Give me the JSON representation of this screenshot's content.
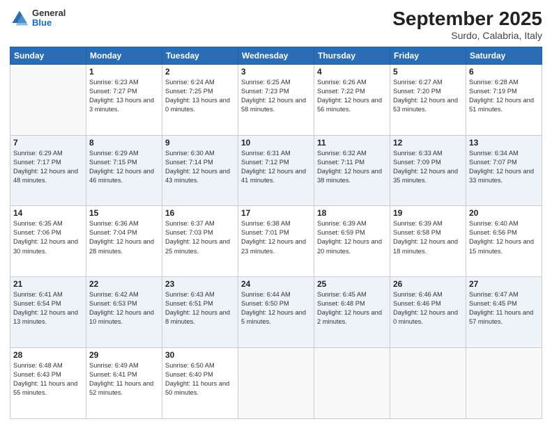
{
  "header": {
    "logo": {
      "general": "General",
      "blue": "Blue"
    },
    "title": "September 2025",
    "subtitle": "Surdo, Calabria, Italy"
  },
  "calendar": {
    "columns": [
      "Sunday",
      "Monday",
      "Tuesday",
      "Wednesday",
      "Thursday",
      "Friday",
      "Saturday"
    ],
    "rows": [
      [
        {
          "day": "",
          "sunrise": "",
          "sunset": "",
          "daylight": ""
        },
        {
          "day": "1",
          "sunrise": "Sunrise: 6:23 AM",
          "sunset": "Sunset: 7:27 PM",
          "daylight": "Daylight: 13 hours and 3 minutes."
        },
        {
          "day": "2",
          "sunrise": "Sunrise: 6:24 AM",
          "sunset": "Sunset: 7:25 PM",
          "daylight": "Daylight: 13 hours and 0 minutes."
        },
        {
          "day": "3",
          "sunrise": "Sunrise: 6:25 AM",
          "sunset": "Sunset: 7:23 PM",
          "daylight": "Daylight: 12 hours and 58 minutes."
        },
        {
          "day": "4",
          "sunrise": "Sunrise: 6:26 AM",
          "sunset": "Sunset: 7:22 PM",
          "daylight": "Daylight: 12 hours and 56 minutes."
        },
        {
          "day": "5",
          "sunrise": "Sunrise: 6:27 AM",
          "sunset": "Sunset: 7:20 PM",
          "daylight": "Daylight: 12 hours and 53 minutes."
        },
        {
          "day": "6",
          "sunrise": "Sunrise: 6:28 AM",
          "sunset": "Sunset: 7:19 PM",
          "daylight": "Daylight: 12 hours and 51 minutes."
        }
      ],
      [
        {
          "day": "7",
          "sunrise": "Sunrise: 6:29 AM",
          "sunset": "Sunset: 7:17 PM",
          "daylight": "Daylight: 12 hours and 48 minutes."
        },
        {
          "day": "8",
          "sunrise": "Sunrise: 6:29 AM",
          "sunset": "Sunset: 7:15 PM",
          "daylight": "Daylight: 12 hours and 46 minutes."
        },
        {
          "day": "9",
          "sunrise": "Sunrise: 6:30 AM",
          "sunset": "Sunset: 7:14 PM",
          "daylight": "Daylight: 12 hours and 43 minutes."
        },
        {
          "day": "10",
          "sunrise": "Sunrise: 6:31 AM",
          "sunset": "Sunset: 7:12 PM",
          "daylight": "Daylight: 12 hours and 41 minutes."
        },
        {
          "day": "11",
          "sunrise": "Sunrise: 6:32 AM",
          "sunset": "Sunset: 7:11 PM",
          "daylight": "Daylight: 12 hours and 38 minutes."
        },
        {
          "day": "12",
          "sunrise": "Sunrise: 6:33 AM",
          "sunset": "Sunset: 7:09 PM",
          "daylight": "Daylight: 12 hours and 35 minutes."
        },
        {
          "day": "13",
          "sunrise": "Sunrise: 6:34 AM",
          "sunset": "Sunset: 7:07 PM",
          "daylight": "Daylight: 12 hours and 33 minutes."
        }
      ],
      [
        {
          "day": "14",
          "sunrise": "Sunrise: 6:35 AM",
          "sunset": "Sunset: 7:06 PM",
          "daylight": "Daylight: 12 hours and 30 minutes."
        },
        {
          "day": "15",
          "sunrise": "Sunrise: 6:36 AM",
          "sunset": "Sunset: 7:04 PM",
          "daylight": "Daylight: 12 hours and 28 minutes."
        },
        {
          "day": "16",
          "sunrise": "Sunrise: 6:37 AM",
          "sunset": "Sunset: 7:03 PM",
          "daylight": "Daylight: 12 hours and 25 minutes."
        },
        {
          "day": "17",
          "sunrise": "Sunrise: 6:38 AM",
          "sunset": "Sunset: 7:01 PM",
          "daylight": "Daylight: 12 hours and 23 minutes."
        },
        {
          "day": "18",
          "sunrise": "Sunrise: 6:39 AM",
          "sunset": "Sunset: 6:59 PM",
          "daylight": "Daylight: 12 hours and 20 minutes."
        },
        {
          "day": "19",
          "sunrise": "Sunrise: 6:39 AM",
          "sunset": "Sunset: 6:58 PM",
          "daylight": "Daylight: 12 hours and 18 minutes."
        },
        {
          "day": "20",
          "sunrise": "Sunrise: 6:40 AM",
          "sunset": "Sunset: 6:56 PM",
          "daylight": "Daylight: 12 hours and 15 minutes."
        }
      ],
      [
        {
          "day": "21",
          "sunrise": "Sunrise: 6:41 AM",
          "sunset": "Sunset: 6:54 PM",
          "daylight": "Daylight: 12 hours and 13 minutes."
        },
        {
          "day": "22",
          "sunrise": "Sunrise: 6:42 AM",
          "sunset": "Sunset: 6:53 PM",
          "daylight": "Daylight: 12 hours and 10 minutes."
        },
        {
          "day": "23",
          "sunrise": "Sunrise: 6:43 AM",
          "sunset": "Sunset: 6:51 PM",
          "daylight": "Daylight: 12 hours and 8 minutes."
        },
        {
          "day": "24",
          "sunrise": "Sunrise: 6:44 AM",
          "sunset": "Sunset: 6:50 PM",
          "daylight": "Daylight: 12 hours and 5 minutes."
        },
        {
          "day": "25",
          "sunrise": "Sunrise: 6:45 AM",
          "sunset": "Sunset: 6:48 PM",
          "daylight": "Daylight: 12 hours and 2 minutes."
        },
        {
          "day": "26",
          "sunrise": "Sunrise: 6:46 AM",
          "sunset": "Sunset: 6:46 PM",
          "daylight": "Daylight: 12 hours and 0 minutes."
        },
        {
          "day": "27",
          "sunrise": "Sunrise: 6:47 AM",
          "sunset": "Sunset: 6:45 PM",
          "daylight": "Daylight: 11 hours and 57 minutes."
        }
      ],
      [
        {
          "day": "28",
          "sunrise": "Sunrise: 6:48 AM",
          "sunset": "Sunset: 6:43 PM",
          "daylight": "Daylight: 11 hours and 55 minutes."
        },
        {
          "day": "29",
          "sunrise": "Sunrise: 6:49 AM",
          "sunset": "Sunset: 6:41 PM",
          "daylight": "Daylight: 11 hours and 52 minutes."
        },
        {
          "day": "30",
          "sunrise": "Sunrise: 6:50 AM",
          "sunset": "Sunset: 6:40 PM",
          "daylight": "Daylight: 11 hours and 50 minutes."
        },
        {
          "day": "",
          "sunrise": "",
          "sunset": "",
          "daylight": ""
        },
        {
          "day": "",
          "sunrise": "",
          "sunset": "",
          "daylight": ""
        },
        {
          "day": "",
          "sunrise": "",
          "sunset": "",
          "daylight": ""
        },
        {
          "day": "",
          "sunrise": "",
          "sunset": "",
          "daylight": ""
        }
      ]
    ]
  }
}
